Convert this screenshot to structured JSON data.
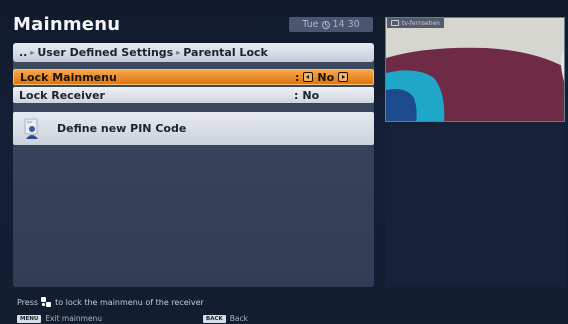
{
  "header": {
    "title": "Mainmenu",
    "day": "Tue",
    "time": "14 30"
  },
  "breadcrumb": {
    "prefix": "..",
    "items": [
      "User Defined Settings",
      "Parental Lock"
    ]
  },
  "settings": [
    {
      "label": "Lock Mainmenu",
      "value": "No",
      "selected": true
    },
    {
      "label": "Lock Receiver",
      "value": "No",
      "selected": false
    }
  ],
  "pin_item": {
    "label": "Define new PIN Code",
    "icon": "person-key-icon"
  },
  "preview": {
    "tag_label": "tv-fernsehen",
    "icon": "tv-icon"
  },
  "footer": {
    "hint_prefix": "Press",
    "hint_suffix": "to lock the mainmenu of the receiver",
    "keys": [
      {
        "key": "MENU",
        "label": "Exit mainmenu"
      },
      {
        "key": "BACK",
        "label": "Back"
      }
    ]
  },
  "colors": {
    "background": "#131d30",
    "panel": "#35425a",
    "highlight": "#e98a24",
    "breadcrumb": "#d5dbe4"
  }
}
